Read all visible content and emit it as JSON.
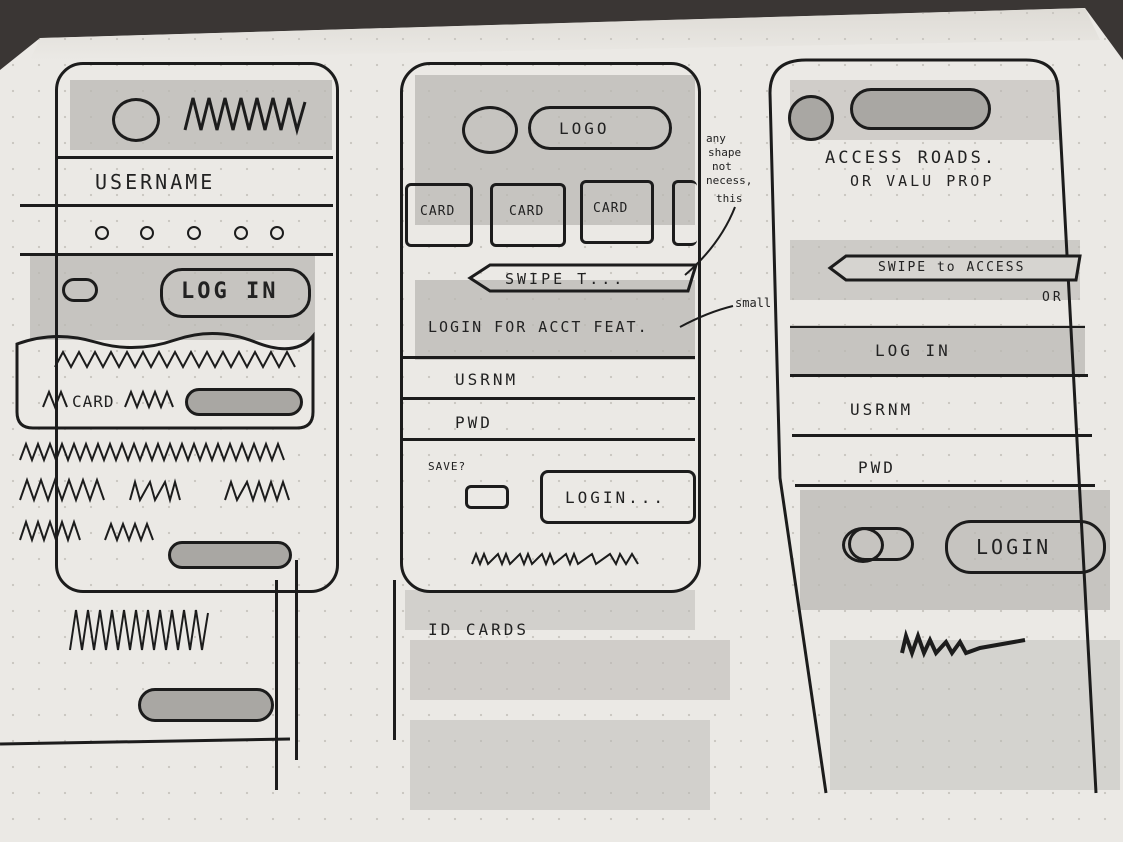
{
  "sketch1": {
    "username_label": "USERNAME",
    "login_button": "LOG IN",
    "card_label": "CARD"
  },
  "sketch2": {
    "logo_label": "LOGO",
    "cards": [
      "CARD",
      "CARD",
      "CARD"
    ],
    "swipe_label": "SWIPE T...",
    "login_feat_label": "LOGIN FOR ACCT FEAT.",
    "username_label": "USRNM",
    "password_label": "PWD",
    "save_label": "SAVE?",
    "login_button": "LOGIN...",
    "caption": "ID CARDS"
  },
  "annotations": {
    "shape_note": [
      "any",
      "shape",
      "not",
      "necess,",
      "this"
    ],
    "small_note": "small"
  },
  "sketch3": {
    "access_text_1": "ACCESS ROADS.",
    "access_text_2": "OR VALU PROP",
    "swipe_label": "SWIPE to ACCESS",
    "or_label": "OR",
    "login_label": "LOG IN",
    "username_label": "USRNM",
    "password_label": "PWD",
    "login_button": "LOGIN"
  }
}
